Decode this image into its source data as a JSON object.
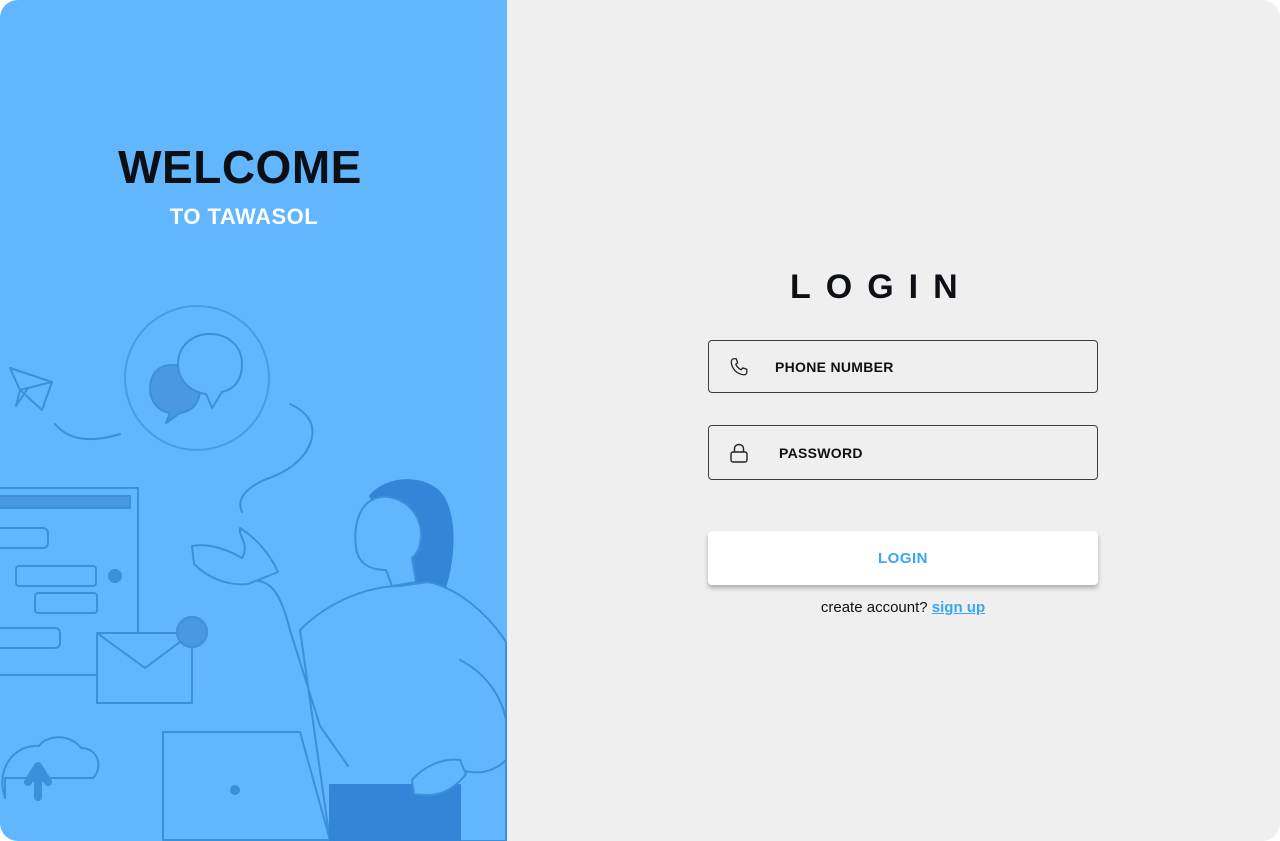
{
  "welcome": {
    "title": "WELCOME",
    "subtitle": "TO TAWASOL"
  },
  "login": {
    "title": "LOGIN",
    "phone_placeholder": "PHONE NUMBER",
    "password_placeholder": "PASSWORD",
    "button_label": "LOGIN",
    "create_account_text": "create account?",
    "signup_label": "sign up"
  },
  "icons": {
    "phone": "phone-icon",
    "password": "lock-icon"
  },
  "colors": {
    "left_panel": "#62b6fd",
    "accent": "#3aa6f2",
    "background": "#efefef"
  }
}
